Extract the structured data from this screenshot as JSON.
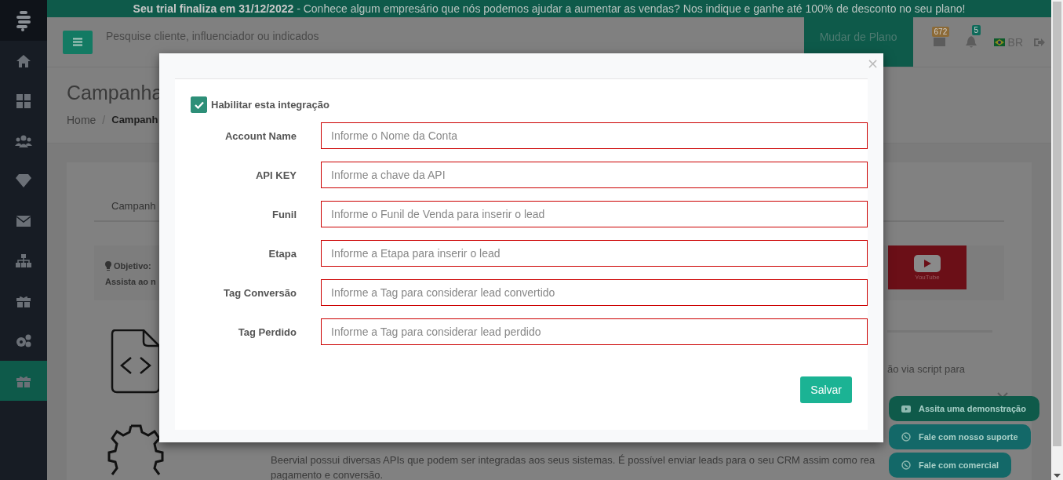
{
  "banner": {
    "text": "**Seu trial finaliza em 31/12/2022** - Conhece algum empresário que nós podemos ajudar a aumentar as vendas? Nos indique e ganhe até 100% de desconto no seu plano!"
  },
  "sidebar": {
    "items": [
      {
        "kind": "home",
        "selected": false
      },
      {
        "kind": "dashboard",
        "selected": false
      },
      {
        "kind": "users",
        "selected": false
      },
      {
        "kind": "diamond",
        "selected": false
      },
      {
        "kind": "mail",
        "selected": false
      },
      {
        "kind": "sitemap",
        "selected": false
      },
      {
        "kind": "gift",
        "selected": false
      },
      {
        "kind": "gears",
        "selected": false
      },
      {
        "kind": "gift",
        "selected": true
      }
    ]
  },
  "header": {
    "search_placeholder": "Pesquise cliente, influenciador ou indicados",
    "plan_button": "Mudar de Plano",
    "mail_count": "672",
    "notification_count": "5",
    "language": "BR"
  },
  "page": {
    "title": "Campanha",
    "breadcrumb": [
      "Home",
      "Campanh"
    ],
    "breadcrumb_separator": "/",
    "tab": "Campanh",
    "objective_label": "Objetivo:",
    "objective_text": "Assista ao n",
    "video_label": "YouTube",
    "script_text": "ão via script para",
    "api_text": [
      "Beervial possui diversas APIs que podem ser integradas aos seus sistemas. É possível enviar leads para o seu CRM assim como rea",
      "pagamento e conversão."
    ]
  },
  "modal": {
    "enable": {
      "label": "Habilitar esta integração",
      "checked": true
    },
    "fields": [
      {
        "label": "Account Name",
        "placeholder": "Informe o Nome da Conta"
      },
      {
        "label": "API KEY",
        "placeholder": "Informe a chave da API"
      },
      {
        "label": "Funil",
        "placeholder": "Informe o Funil de Venda para inserir o lead"
      },
      {
        "label": "Etapa",
        "placeholder": "Informe a Etapa para inserir o lead"
      },
      {
        "label": "Tag Conversão",
        "placeholder": "Informe a Tag para considerar lead convertido"
      },
      {
        "label": "Tag Perdido",
        "placeholder": "Informe a Tag para considerar lead perdido"
      }
    ],
    "save": "Salvar",
    "close": "×"
  },
  "floating_buttons": [
    {
      "kind": "video",
      "label": "Assita uma demonstração"
    },
    {
      "kind": "whatsapp",
      "label": "Fale com nosso suporte"
    },
    {
      "kind": "whatsapp",
      "label": "Fale com comercial"
    }
  ]
}
